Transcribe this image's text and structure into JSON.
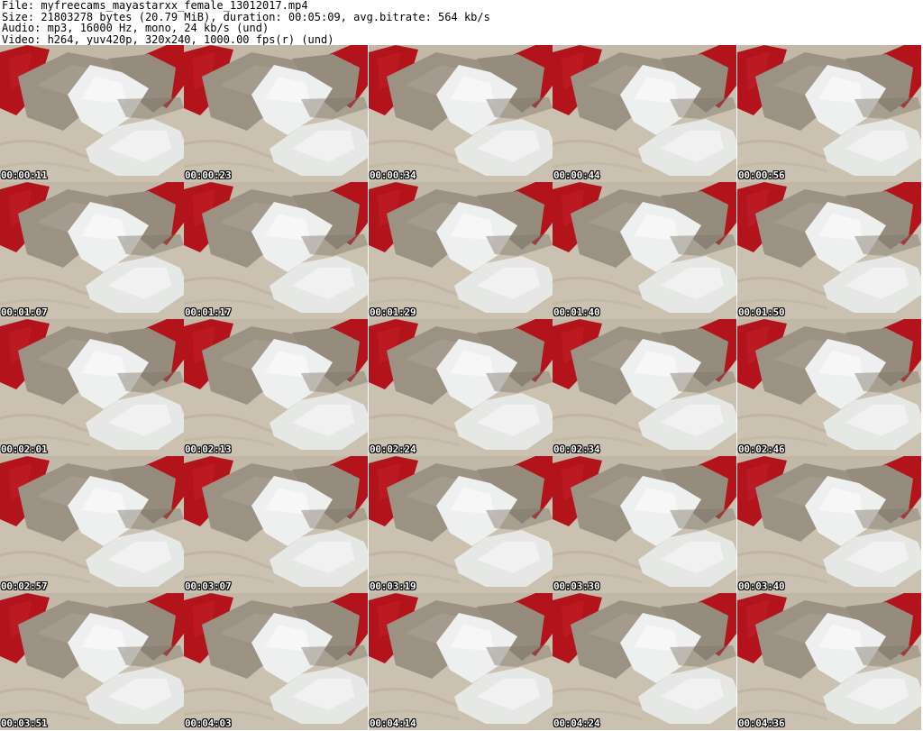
{
  "header": {
    "file_line": "File: myfreecams_mayastarxx_female_13012017.mp4",
    "size_line": "Size: 21803278 bytes (20.79 MiB), duration: 00:05:09, avg.bitrate: 564 kb/s",
    "audio_line": "Audio: mp3, 16000 Hz, mono, 24 kb/s (und)",
    "video_line": "Video: h264, yuv420p, 320x240, 1000.00 fps(r) (und)"
  },
  "thumbnails": [
    {
      "timestamp": "00:00:11"
    },
    {
      "timestamp": "00:00:23"
    },
    {
      "timestamp": "00:00:34"
    },
    {
      "timestamp": "00:00:44"
    },
    {
      "timestamp": "00:00:56"
    },
    {
      "timestamp": "00:01:07"
    },
    {
      "timestamp": "00:01:17"
    },
    {
      "timestamp": "00:01:29"
    },
    {
      "timestamp": "00:01:40"
    },
    {
      "timestamp": "00:01:50"
    },
    {
      "timestamp": "00:02:01"
    },
    {
      "timestamp": "00:02:13"
    },
    {
      "timestamp": "00:02:24"
    },
    {
      "timestamp": "00:02:34"
    },
    {
      "timestamp": "00:02:46"
    },
    {
      "timestamp": "00:02:57"
    },
    {
      "timestamp": "00:03:07"
    },
    {
      "timestamp": "00:03:19"
    },
    {
      "timestamp": "00:03:30"
    },
    {
      "timestamp": "00:03:40"
    },
    {
      "timestamp": "00:03:51"
    },
    {
      "timestamp": "00:04:03"
    },
    {
      "timestamp": "00:04:14"
    },
    {
      "timestamp": "00:04:24"
    },
    {
      "timestamp": "00:04:36"
    }
  ],
  "colors": {
    "red_pillow": "#b3141c",
    "taupe_pillow": "#9c9284",
    "white_pillow": "#eef0ef",
    "blanket": "#cbc1b1"
  }
}
